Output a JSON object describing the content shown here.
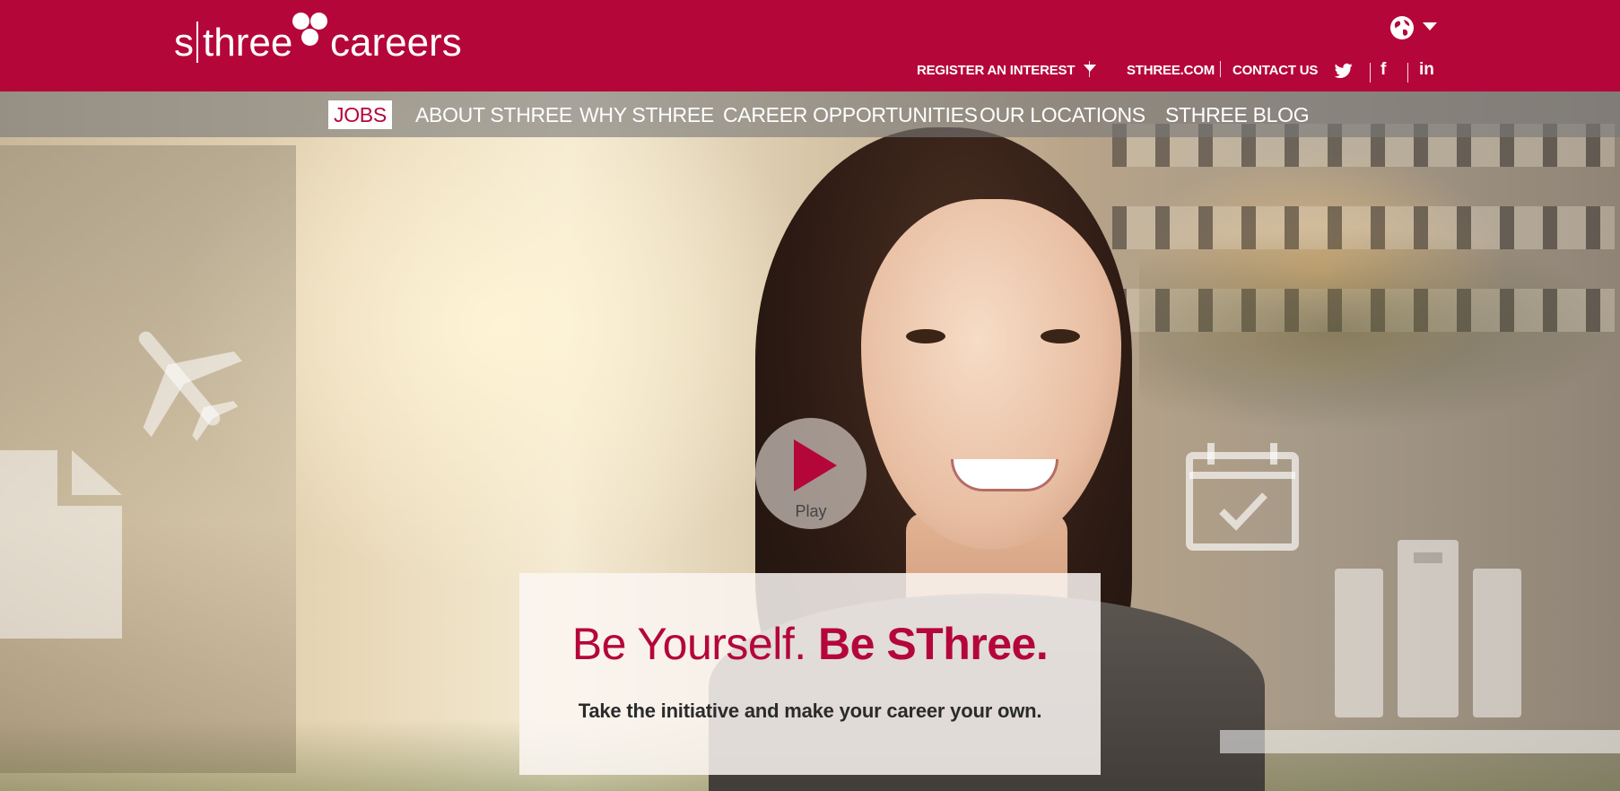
{
  "brand": {
    "logo_s": "s",
    "logo_three": "three",
    "logo_careers": "careers",
    "primary_color": "#b5063a"
  },
  "header": {
    "language_icon": "globe-icon",
    "utility_nav": {
      "register_interest": "REGISTER AN INTEREST",
      "sthree_com": "STHREE.COM",
      "contact_us": "CONTACT US"
    },
    "social": {
      "twitter_icon": "twitter-icon",
      "facebook_glyph": "f",
      "linkedin_glyph": "in"
    }
  },
  "main_nav": {
    "items": [
      {
        "label": "JOBS",
        "active": true
      },
      {
        "label": "ABOUT STHREE",
        "active": false
      },
      {
        "label": "WHY STHREE",
        "active": false
      },
      {
        "label": "CAREER OPPORTUNITIES",
        "active": false
      },
      {
        "label": "OUR LOCATIONS",
        "active": false
      },
      {
        "label": "STHREE BLOG",
        "active": false
      }
    ]
  },
  "hero": {
    "play_label": "Play",
    "headline_light": "Be Yourself. ",
    "headline_bold": "Be SThree.",
    "subline": "Take the initiative and make your career your own."
  }
}
